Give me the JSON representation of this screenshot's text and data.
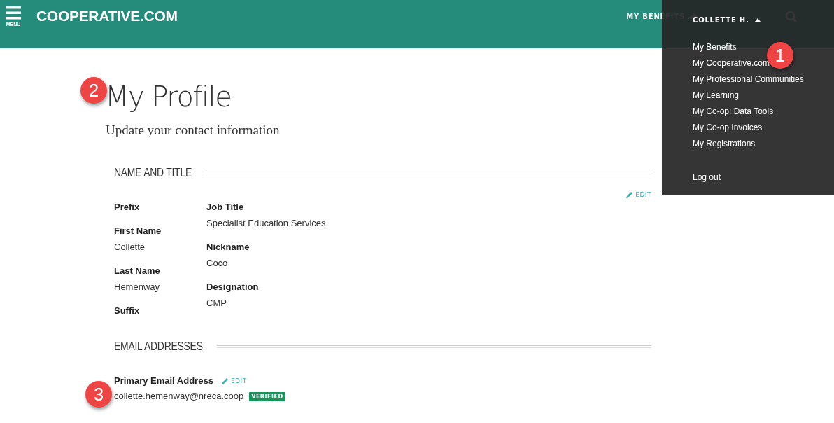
{
  "header": {
    "menu_label": "MENU",
    "logo": "COOPERATIVE.COM",
    "nav_link": "MY BENEFITS",
    "user": "COLLETTE H.",
    "user_menu_expanded": true
  },
  "user_menu": {
    "items": [
      {
        "label": "My Benefits",
        "kind": "link"
      },
      {
        "label": "My Cooperative.com",
        "kind": "link"
      },
      {
        "label": "My Professional Communities",
        "kind": "link"
      },
      {
        "label": "My Learning",
        "kind": "link"
      },
      {
        "label": "My Co-op: Data Tools",
        "kind": "link"
      },
      {
        "label": "My Co-op Invoices",
        "kind": "link"
      },
      {
        "label": "My Registrations",
        "kind": "link"
      },
      {
        "label": "Log out",
        "kind": "logout"
      }
    ]
  },
  "page": {
    "title": "My Profile",
    "subtitle": "Update your contact information"
  },
  "name_section": {
    "heading": "NAME AND TITLE",
    "edit": "EDIT",
    "left_fields": [
      {
        "label": "Prefix"
      },
      {
        "label": "First Name",
        "value": "Collette"
      },
      {
        "label": "Last Name",
        "value": "Hemenway"
      },
      {
        "label": "Suffix"
      }
    ],
    "right_fields": [
      {
        "label": "Job Title",
        "value": "Specialist Education Services"
      },
      {
        "label": "Nickname",
        "value": "Coco"
      },
      {
        "label": "Designation",
        "value": "CMP"
      }
    ]
  },
  "email_section": {
    "heading": "EMAIL ADDRESSES",
    "label": "Primary Email Address",
    "edit": "EDIT",
    "email": "collette.hemenway@nreca.coop",
    "badge": "VERIFIED"
  },
  "callouts": [
    {
      "text": "1"
    },
    {
      "text": "2"
    },
    {
      "text": "3"
    }
  ]
}
